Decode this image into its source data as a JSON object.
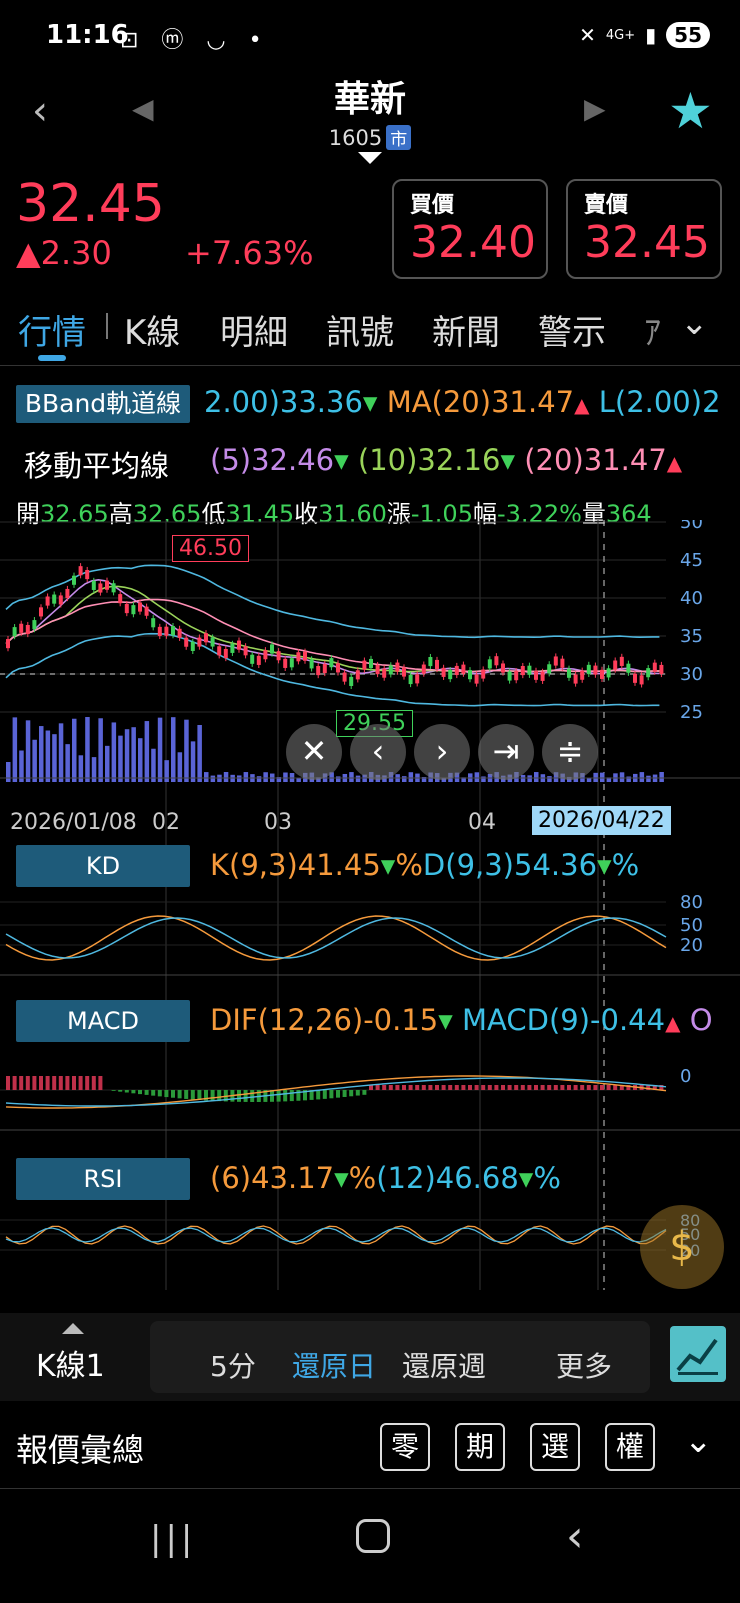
{
  "status_bar": {
    "time": "11:16",
    "left_icons": "⊡ ⓜ ◡ •",
    "network": "4G+",
    "battery": "55"
  },
  "header": {
    "title": "華新",
    "code": "1605",
    "market_badge": "市",
    "prev_icon": "chevron-left-icon",
    "next_icon": "triangle-right-icon",
    "favorite_icon": "star-icon",
    "favorite_color": "#4fd1d9"
  },
  "quote": {
    "price": "32.45",
    "change": "▲2.30",
    "change_pct": "+7.63%",
    "bid_label": "買價",
    "bid_value": "32.40",
    "ask_label": "賣價",
    "ask_value": "32.45",
    "up_color": "#ff3d5a"
  },
  "tabs": [
    "行情",
    "K線",
    "明細",
    "訊號",
    "新聞",
    "警示",
    "ｱ"
  ],
  "active_tab": "行情",
  "bband": {
    "label": "BBand軌道線",
    "upper": "2.00)33.36",
    "ma": "MA(20)31.47",
    "lower": "L(2.00)2"
  },
  "ma_line": {
    "label": "移動平均線",
    "ma5": "(5)32.46",
    "ma10": "(10)32.16",
    "ma20": "(20)31.47"
  },
  "ohlc": {
    "open_label": "開",
    "open": "32.65",
    "high_label": "高",
    "high": "32.65",
    "low_label": "低",
    "low": "31.45",
    "close_label": "收",
    "close": "31.60",
    "chg_label": "漲",
    "chg": "-1.05",
    "amp_label": "幅",
    "amp": "-3.22%",
    "vol_label": "量",
    "vol": "364"
  },
  "price_chart": {
    "y_ticks": [
      "50",
      "45",
      "40",
      "35",
      "30",
      "25"
    ],
    "max_marker": "46.50",
    "min_marker": "29.55",
    "x_labels": [
      "2026/01/08",
      "02",
      "03",
      "04"
    ],
    "selected_date": "2026/04/22"
  },
  "chart_controls": [
    "close-icon",
    "chevron-left-icon",
    "chevron-right-icon",
    "skip-end-icon",
    "collapse-icon"
  ],
  "kd": {
    "label": "KD",
    "k": "K(9,3)41.45",
    "d": "D(9,3)54.36",
    "y_ticks": [
      "80",
      "50",
      "20"
    ]
  },
  "macd": {
    "label": "MACD",
    "dif": "DIF(12,26)-0.15",
    "macd": "MACD(9)-0.44",
    "osc": "O",
    "y_ticks": [
      "0"
    ]
  },
  "rsi": {
    "label": "RSI",
    "rsi6": "(6)43.17",
    "rsi12": "(12)46.68",
    "y_ticks": [
      "80",
      "50",
      "20"
    ]
  },
  "toolbar": {
    "kline": "K線1",
    "items": [
      "5分",
      "還原日",
      "還原週",
      "更多"
    ],
    "active": "還原日"
  },
  "summary": {
    "title": "報價彙總",
    "buttons": [
      "零",
      "期",
      "選",
      "權"
    ]
  },
  "system_nav": [
    "recent-apps-icon",
    "home-icon",
    "back-icon"
  ]
}
